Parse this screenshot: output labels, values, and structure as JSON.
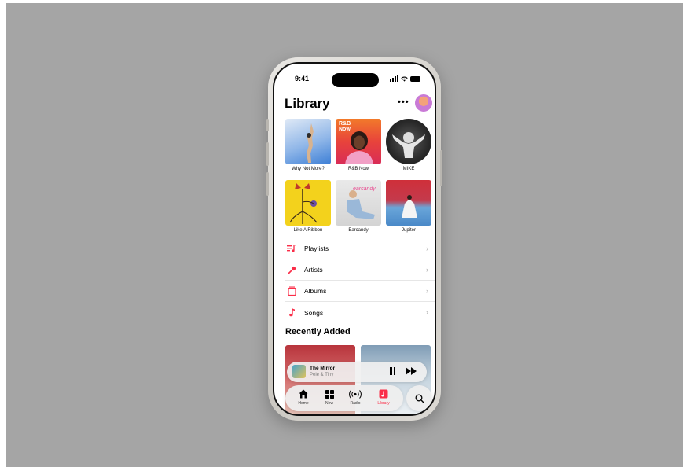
{
  "status_bar": {
    "time": "9:41"
  },
  "header": {
    "title": "Library",
    "more_label": "•••"
  },
  "albums": [
    {
      "title": "Why Not More?"
    },
    {
      "title": "R&B Now"
    },
    {
      "title": "MIKE"
    },
    {
      "title": "Like A Ribbon"
    },
    {
      "title": "Earcandy"
    },
    {
      "title": "Jupiter"
    }
  ],
  "library_rows": [
    {
      "label": "Playlists",
      "icon": "playlist-icon"
    },
    {
      "label": "Artists",
      "icon": "microphone-icon"
    },
    {
      "label": "Albums",
      "icon": "album-stack-icon"
    },
    {
      "label": "Songs",
      "icon": "music-note-icon"
    }
  ],
  "recent": {
    "title": "Recently Added"
  },
  "mini_player": {
    "song": "The Mirror",
    "artist": "Pele & Tiny"
  },
  "tabs": [
    {
      "label": "Home",
      "icon": "home-icon"
    },
    {
      "label": "New",
      "icon": "grid-icon"
    },
    {
      "label": "Radio",
      "icon": "radio-icon"
    },
    {
      "label": "Library",
      "icon": "library-icon",
      "active": true
    }
  ],
  "colors": {
    "accent": "#fa2d48",
    "backdrop": "#a5a5a5"
  }
}
